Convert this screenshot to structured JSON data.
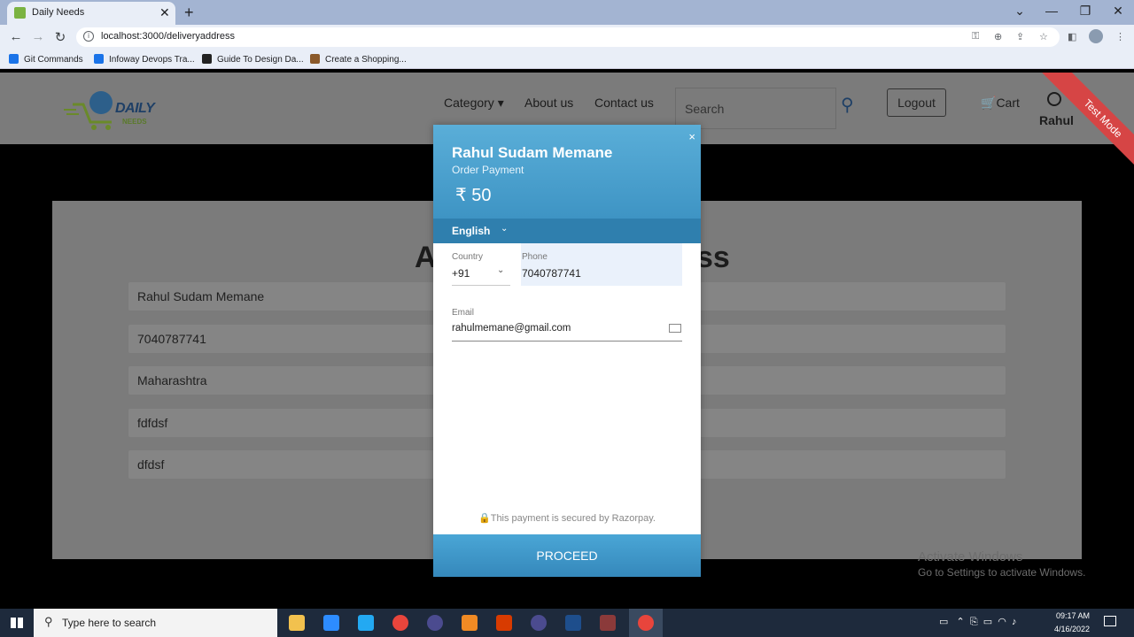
{
  "browser": {
    "tab_title": "Daily Needs",
    "tab_close": "✕",
    "new_tab": "+",
    "url": "localhost:3000/deliveryaddress",
    "bookmarks": [
      "Git Commands",
      "Infoway Devops Tra...",
      "Guide To Design Da...",
      "Create a Shopping..."
    ],
    "window_controls": {
      "dropdown": "⌄",
      "minimize": "—",
      "maximize": "❐",
      "close": "✕"
    }
  },
  "site": {
    "logo_text": "DAILY",
    "logo_sub": "NEEDS",
    "nav": {
      "category": "Category ▾",
      "about": "About us",
      "contact": "Contact us"
    },
    "search_placeholder": "Search",
    "logout": "Logout",
    "cart": "Cart",
    "user": "Rahul",
    "test_mode": "Test Mode",
    "form_title_left": "A",
    "form_title_right": "ss",
    "fields": [
      "Rahul Sudam Memane",
      "7040787741",
      "Maharashtra",
      "fdfdsf",
      "dfdsf"
    ]
  },
  "payment": {
    "name": "Rahul Sudam Memane",
    "description": "Order Payment",
    "amount": "₹ 50",
    "language": "English",
    "country_label": "Country",
    "country_code": "+91",
    "phone_label": "Phone",
    "phone": "7040787741",
    "email_label": "Email",
    "email": "rahulmemane@gmail.com",
    "secured_text": "This payment is secured by Razorpay.",
    "proceed": "PROCEED",
    "close": "×"
  },
  "watermark": {
    "line1": "Activate Windows",
    "line2": "Go to Settings to activate Windows."
  },
  "taskbar": {
    "search_placeholder": "Type here to search",
    "time": "09:17 AM",
    "date": "4/16/2022"
  }
}
